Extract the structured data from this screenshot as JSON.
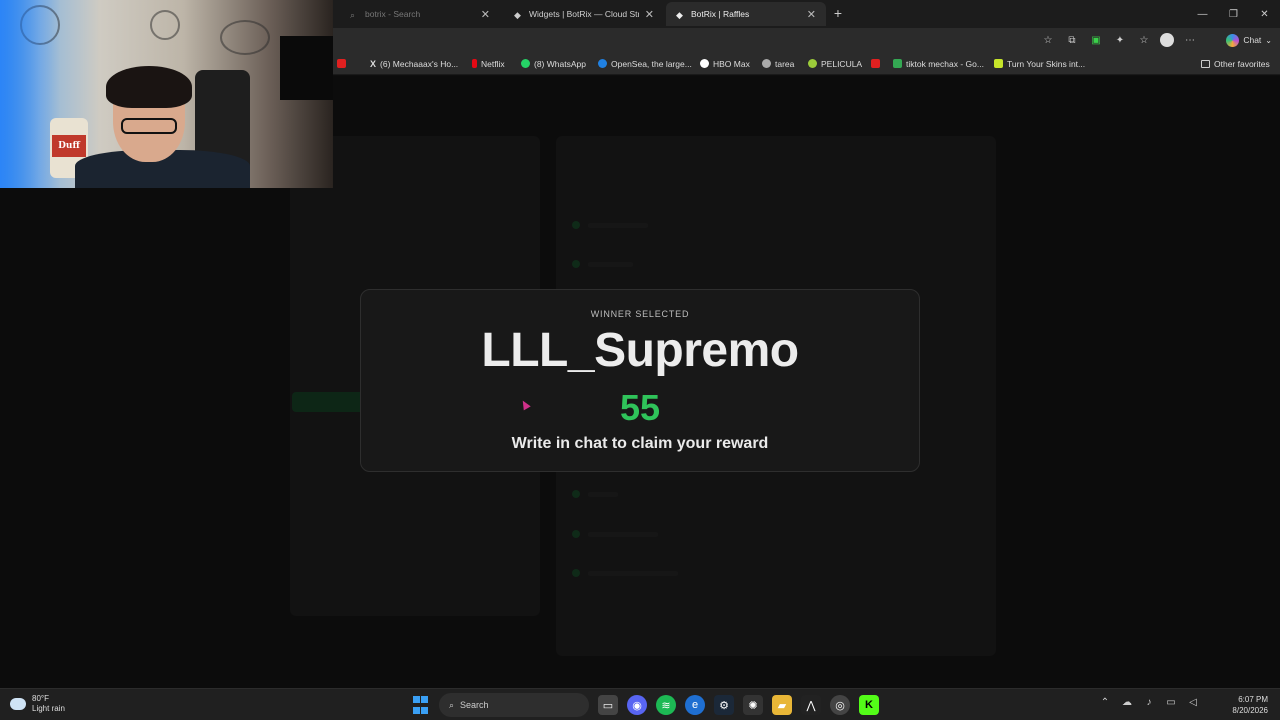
{
  "browser": {
    "tabs": [
      {
        "title": "botrix - Search",
        "active": false
      },
      {
        "title": "Widgets | BotRix — Cloud Streami",
        "active": false
      },
      {
        "title": "BotRix | Raffles",
        "active": true
      }
    ],
    "new_tab": "+",
    "window_controls": {
      "minimize": "—",
      "maximize": "❐",
      "close": "✕"
    },
    "chat_label": "Chat",
    "bookmarks": [
      {
        "label": "(6) Mechaaax's Ho...",
        "color": "#ffffff"
      },
      {
        "label": "Netflix",
        "color": "#e50914"
      },
      {
        "label": "(8) WhatsApp",
        "color": "#25d366"
      },
      {
        "label": "OpenSea, the large...",
        "color": "#2081e2"
      },
      {
        "label": "HBO Max",
        "color": "#ffffff"
      },
      {
        "label": "tarea",
        "color": "#aaaaaa"
      },
      {
        "label": "PELICULA",
        "color": "#9ccc3a"
      },
      {
        "label": "tiktok mechax - Go...",
        "color": "#34a853"
      },
      {
        "label": "Turn Your Skins int...",
        "color": "#c6e52a"
      }
    ],
    "other_favorites": "Other favorites"
  },
  "modal": {
    "label": "WINNER SELECTED",
    "winner_name": "LLL_Supremo",
    "number": "55",
    "claim_text": "Write in chat to claim your reward",
    "number_color": "#2fc35a"
  },
  "webcam": {
    "can_label": "Duff"
  },
  "taskbar": {
    "weather_temp": "80°F",
    "weather_desc": "Light rain",
    "search_placeholder": "Search",
    "time": "6:07 PM",
    "date": "8/20/2026"
  }
}
